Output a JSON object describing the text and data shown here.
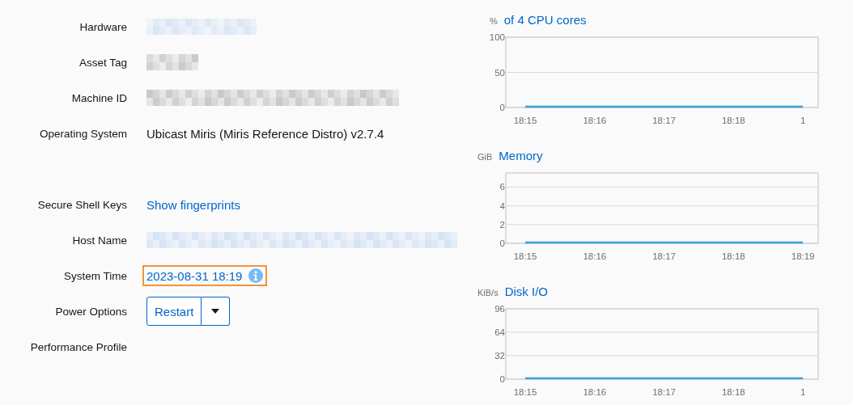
{
  "details": [
    {
      "label": "Hardware",
      "kind": "redacted",
      "color": "#d5e3f4"
    },
    {
      "label": "Asset Tag",
      "kind": "redacted",
      "color": "#c4c4c4"
    },
    {
      "label": "Machine ID",
      "kind": "redacted",
      "color": "#c2c2c2"
    },
    {
      "label": "Operating System",
      "kind": "text",
      "value": "Ubicast Miris (Miris Reference Distro) v2.7.4",
      "gap_after": true
    },
    {
      "label": "Secure Shell Keys",
      "kind": "link",
      "value": "Show fingerprints"
    },
    {
      "label": "Host Name",
      "kind": "redacted",
      "color": "#cfe0f4"
    },
    {
      "label": "System Time",
      "kind": "time",
      "value": "2023-08-31 18:19",
      "focused": true
    },
    {
      "label": "Power Options",
      "kind": "split_button",
      "value": "Restart"
    },
    {
      "label": "Performance Profile",
      "kind": "empty"
    }
  ],
  "charts": [
    {
      "unit": "%",
      "title": "of 4 CPU cores",
      "chart_data": {
        "type": "line",
        "grid": true,
        "ylim": [
          0,
          100
        ],
        "yticks": [
          0,
          50,
          100
        ],
        "categories": [
          "18:15",
          "18:16",
          "18:17",
          "18:18",
          "1"
        ],
        "series": [
          {
            "color": "#3f9fdc",
            "values": [
              0,
              0,
              0,
              0,
              0
            ]
          }
        ]
      }
    },
    {
      "unit": "GiB",
      "title": "Memory",
      "chart_data": {
        "type": "line",
        "grid": true,
        "ylim": [
          0,
          7.5
        ],
        "yticks": [
          0,
          2,
          4,
          6
        ],
        "categories": [
          "18:15",
          "18:16",
          "18:17",
          "18:18",
          "18:19"
        ],
        "series": [
          {
            "color": "#3f9fdc",
            "values": [
              0,
              0,
              0,
              0,
              0
            ]
          }
        ]
      }
    },
    {
      "unit": "KiB/s",
      "title": "Disk I/O",
      "chart_data": {
        "type": "line",
        "grid": true,
        "ylim": [
          0,
          96
        ],
        "yticks": [
          0,
          32,
          64,
          96
        ],
        "categories": [
          "18:15",
          "18:16",
          "18:17",
          "18:18",
          "1"
        ],
        "series": [
          {
            "color": "#3f9fdc",
            "values": [
              0,
              0,
              0,
              0,
              0
            ]
          }
        ]
      }
    }
  ]
}
